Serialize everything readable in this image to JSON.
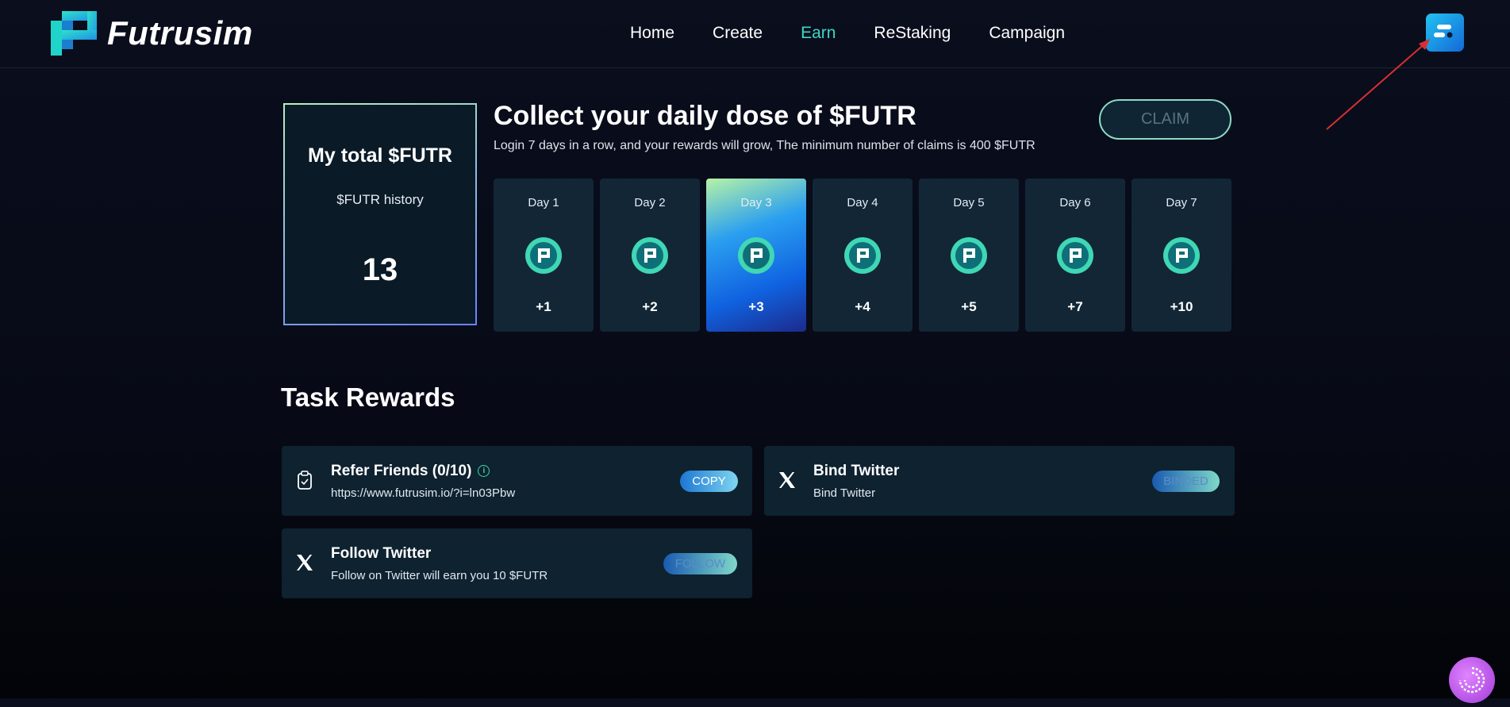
{
  "brand": {
    "name": "Futrusim"
  },
  "nav": {
    "items": [
      {
        "label": "Home"
      },
      {
        "label": "Create"
      },
      {
        "label": "Earn"
      },
      {
        "label": "ReStaking"
      },
      {
        "label": "Campaign"
      }
    ],
    "active": "Earn"
  },
  "total": {
    "title": "My total $FUTR",
    "history_label": "$FUTR history",
    "value": "13"
  },
  "daily": {
    "title": "Collect your daily dose of $FUTR",
    "subtitle": "Login 7 days in a row, and your rewards will grow, The minimum number of claims is 400 $FUTR",
    "claim_label": "CLAIM",
    "days": [
      {
        "label": "Day 1",
        "reward": "+1"
      },
      {
        "label": "Day 2",
        "reward": "+2"
      },
      {
        "label": "Day 3",
        "reward": "+3"
      },
      {
        "label": "Day 4",
        "reward": "+4"
      },
      {
        "label": "Day 5",
        "reward": "+5"
      },
      {
        "label": "Day 6",
        "reward": "+7"
      },
      {
        "label": "Day 7",
        "reward": "+10"
      }
    ],
    "current_day": "Day 3"
  },
  "tasks": {
    "title": "Task Rewards",
    "refer": {
      "name": "Refer Friends (0/10)",
      "sub": "https://www.futrusim.io/?i=ln03Pbw",
      "button": "COPY",
      "icon": "clipboard-icon"
    },
    "bind": {
      "name": "Bind Twitter",
      "sub": "Bind Twitter",
      "button": "BINDED",
      "icon": "x-logo-icon"
    },
    "follow": {
      "name": "Follow Twitter",
      "sub": "Follow on Twitter will earn you 10 $FUTR",
      "button": "FOLLOW",
      "icon": "x-logo-icon"
    }
  },
  "colors": {
    "accent": "#3fd7c4",
    "background": "#0a0e1d",
    "card": "#122636"
  }
}
